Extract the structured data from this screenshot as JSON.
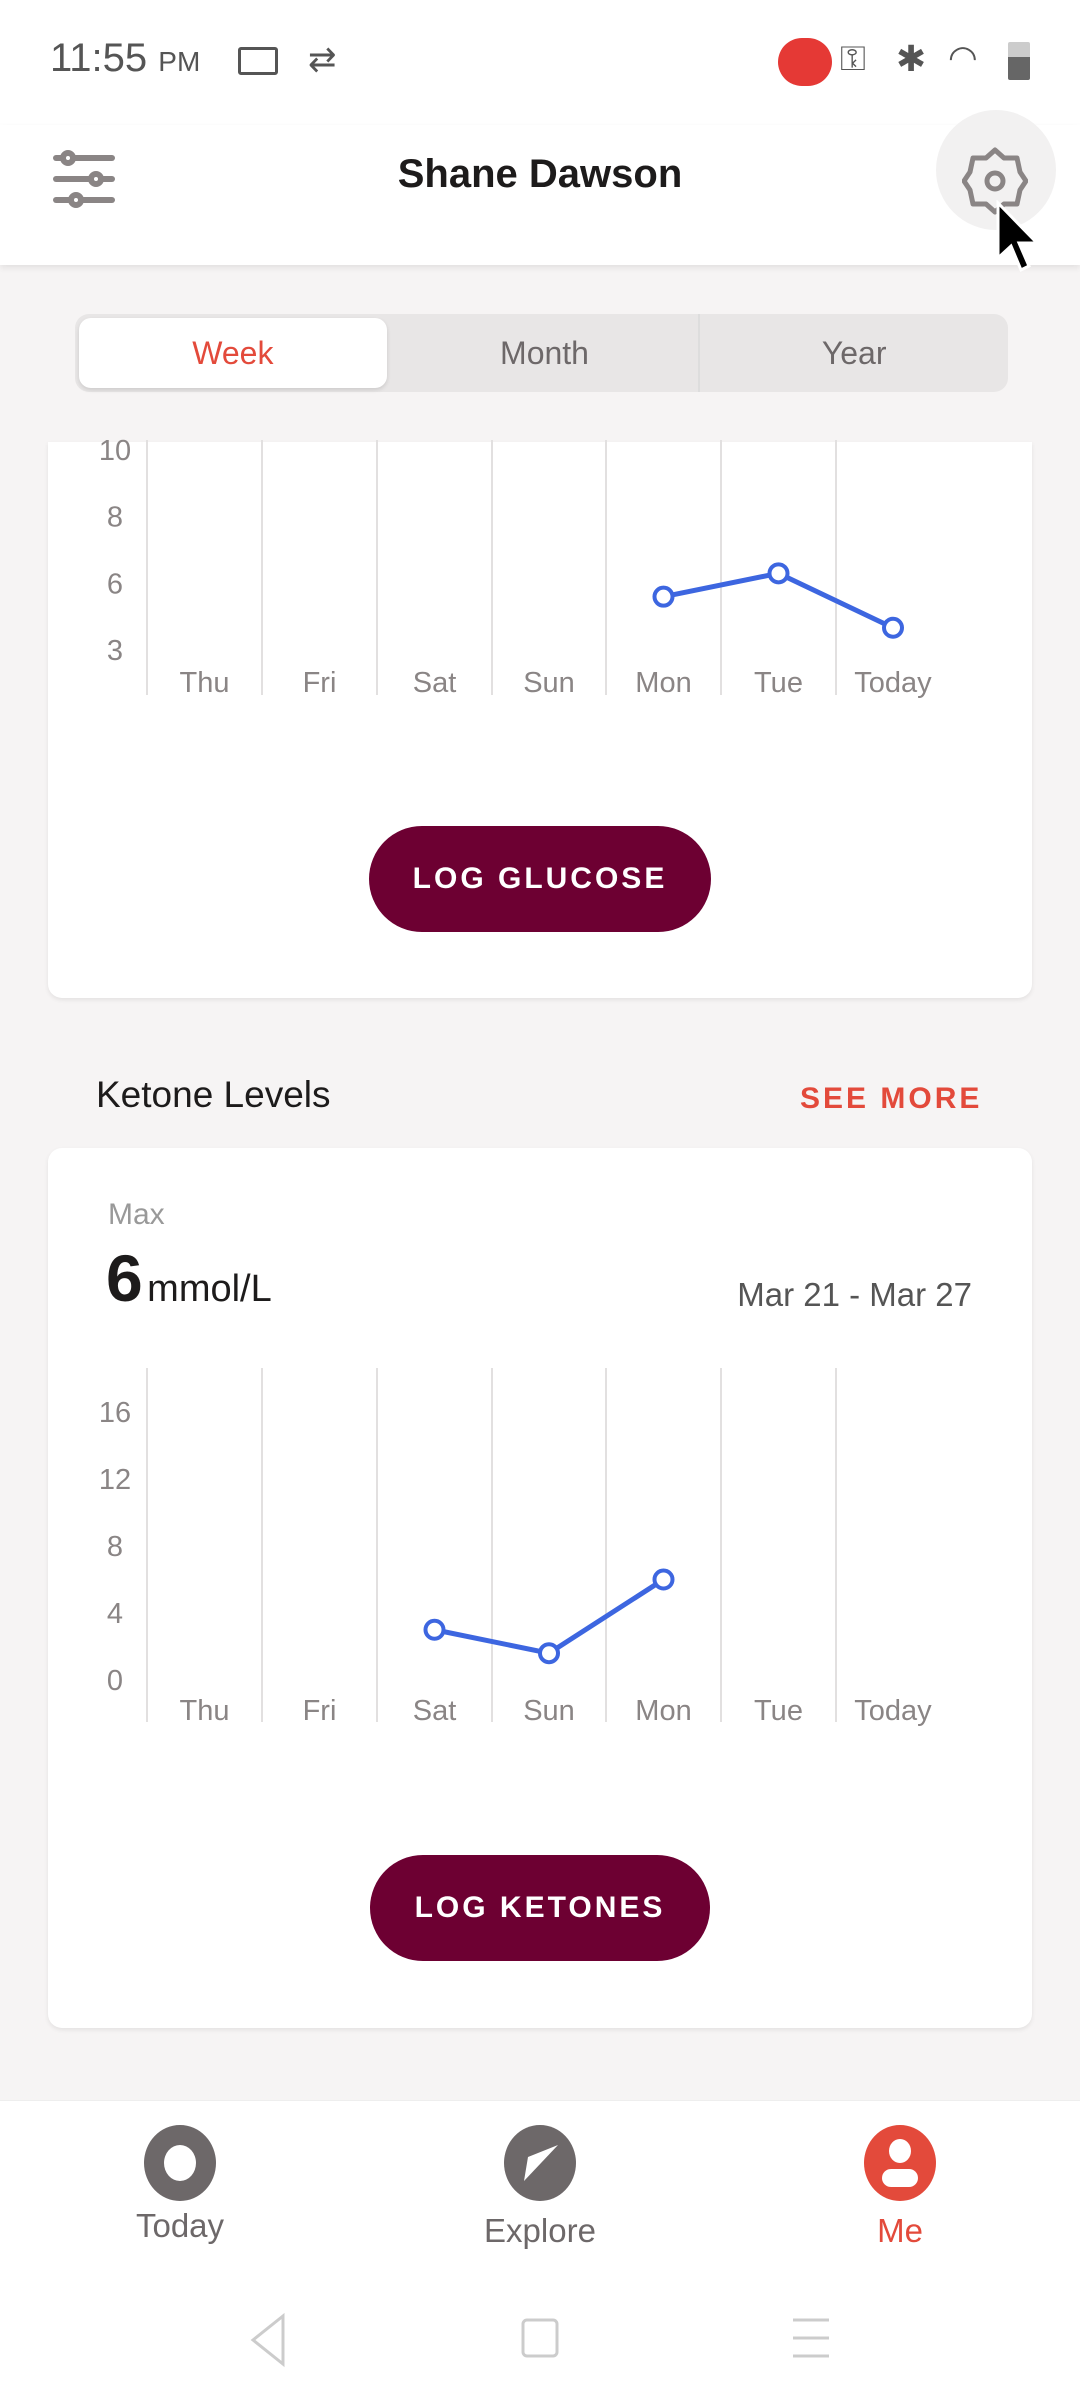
{
  "status_bar": {
    "time": "11:55",
    "ampm": "PM"
  },
  "header": {
    "title": "Shane Dawson",
    "left_icon": "sliders-icon",
    "right_icon": "gear-icon"
  },
  "tabs": [
    {
      "label": "Week",
      "active": true
    },
    {
      "label": "Month",
      "active": false
    },
    {
      "label": "Year",
      "active": false
    }
  ],
  "glucose": {
    "button": "LOG GLUCOSE"
  },
  "ketone": {
    "section_title": "Ketone Levels",
    "see_more": "SEE MORE",
    "max_label": "Max",
    "max_value": "6",
    "max_unit": "mmol/L",
    "date_range": "Mar 21 - Mar 27",
    "button": "LOG KETONES"
  },
  "chart_data": [
    {
      "type": "line",
      "categories": [
        "Thu",
        "Fri",
        "Sat",
        "Sun",
        "Mon",
        "Tue",
        "Today"
      ],
      "y_ticks": [
        10,
        8,
        6,
        3
      ],
      "values": [
        null,
        null,
        null,
        null,
        5.4,
        6.3,
        4.0
      ],
      "color": "#3d66e0",
      "grid": "vertical"
    },
    {
      "type": "line",
      "categories": [
        "Thu",
        "Fri",
        "Sat",
        "Sun",
        "Mon",
        "Tue",
        "Today"
      ],
      "y_ticks": [
        16,
        12,
        8,
        4,
        0
      ],
      "values": [
        null,
        null,
        3,
        1.6,
        6,
        null,
        null
      ],
      "color": "#3d66e0",
      "grid": "vertical"
    }
  ],
  "bottom_nav": [
    {
      "label": "Today",
      "icon": "today-ring-icon"
    },
    {
      "label": "Explore",
      "icon": "compass-icon"
    },
    {
      "label": "Me",
      "icon": "person-icon",
      "active": true
    }
  ],
  "colors": {
    "accent": "#e34a3b",
    "button": "#6d0032",
    "line": "#3d66e0"
  }
}
